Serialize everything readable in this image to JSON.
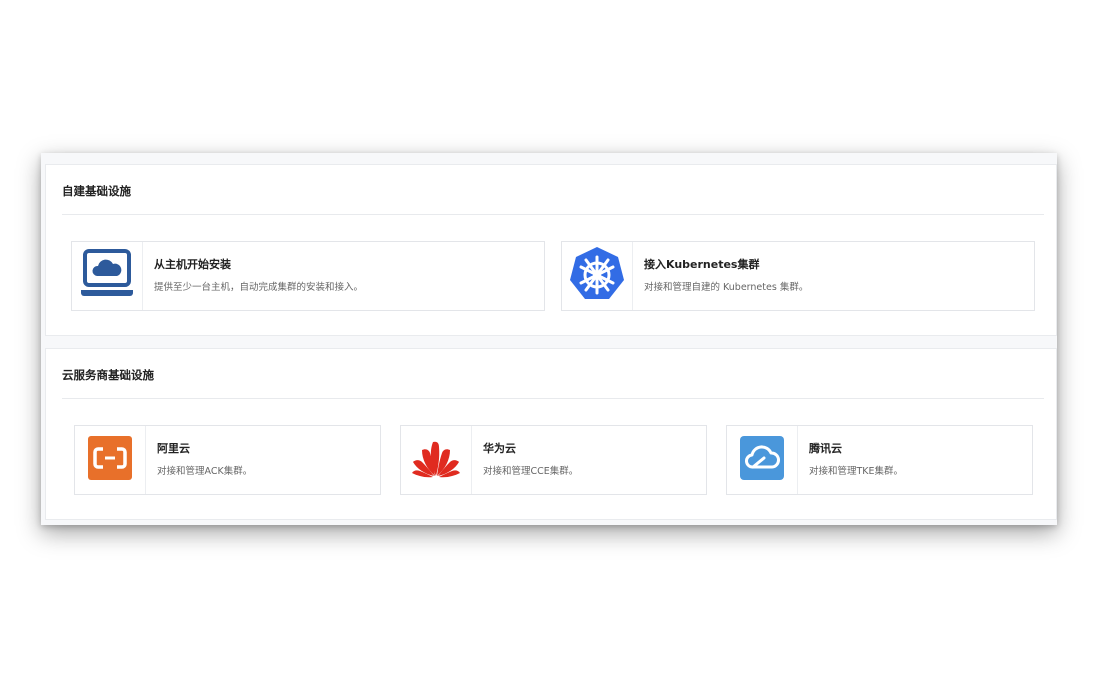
{
  "self_built": {
    "title": "自建基础设施",
    "cards": [
      {
        "title": "从主机开始安装",
        "desc": "提供至少一台主机，自动完成集群的安装和接入。",
        "icon": "laptop-cloud-icon"
      },
      {
        "title": "接入Kubernetes集群",
        "desc": "对接和管理自建的 Kubernetes 集群。",
        "icon": "kubernetes-icon"
      }
    ]
  },
  "cloud": {
    "title": "云服务商基础设施",
    "cards": [
      {
        "title": "阿里云",
        "desc": "对接和管理ACK集群。",
        "icon": "aliyun-icon"
      },
      {
        "title": "华为云",
        "desc": "对接和管理CCE集群。",
        "icon": "huawei-cloud-icon"
      },
      {
        "title": "腾讯云",
        "desc": "对接和管理TKE集群。",
        "icon": "tencent-cloud-icon"
      }
    ]
  },
  "colors": {
    "laptop_blue": "#2d5a9b",
    "k8s_blue": "#326ce5",
    "aliyun_orange": "#e8702a",
    "huawei_red": "#e02b20",
    "tencent_blue": "#4a97db"
  }
}
